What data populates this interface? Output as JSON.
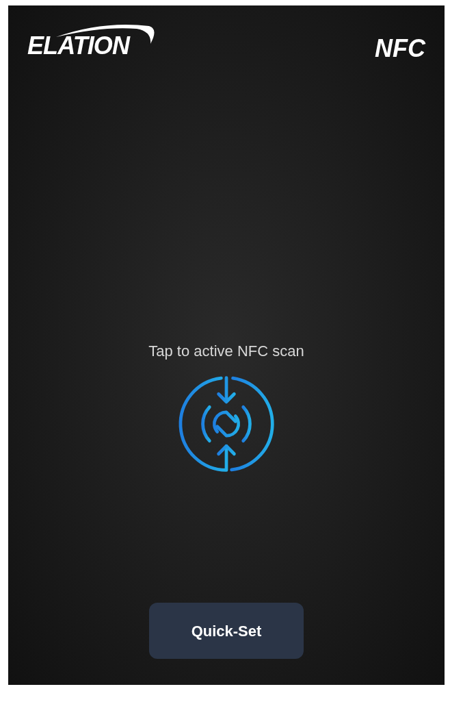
{
  "header": {
    "logo": "ELATION",
    "title": "NFC"
  },
  "scan": {
    "prompt": "Tap to active NFC scan"
  },
  "button": {
    "label": "Quick-Set"
  }
}
